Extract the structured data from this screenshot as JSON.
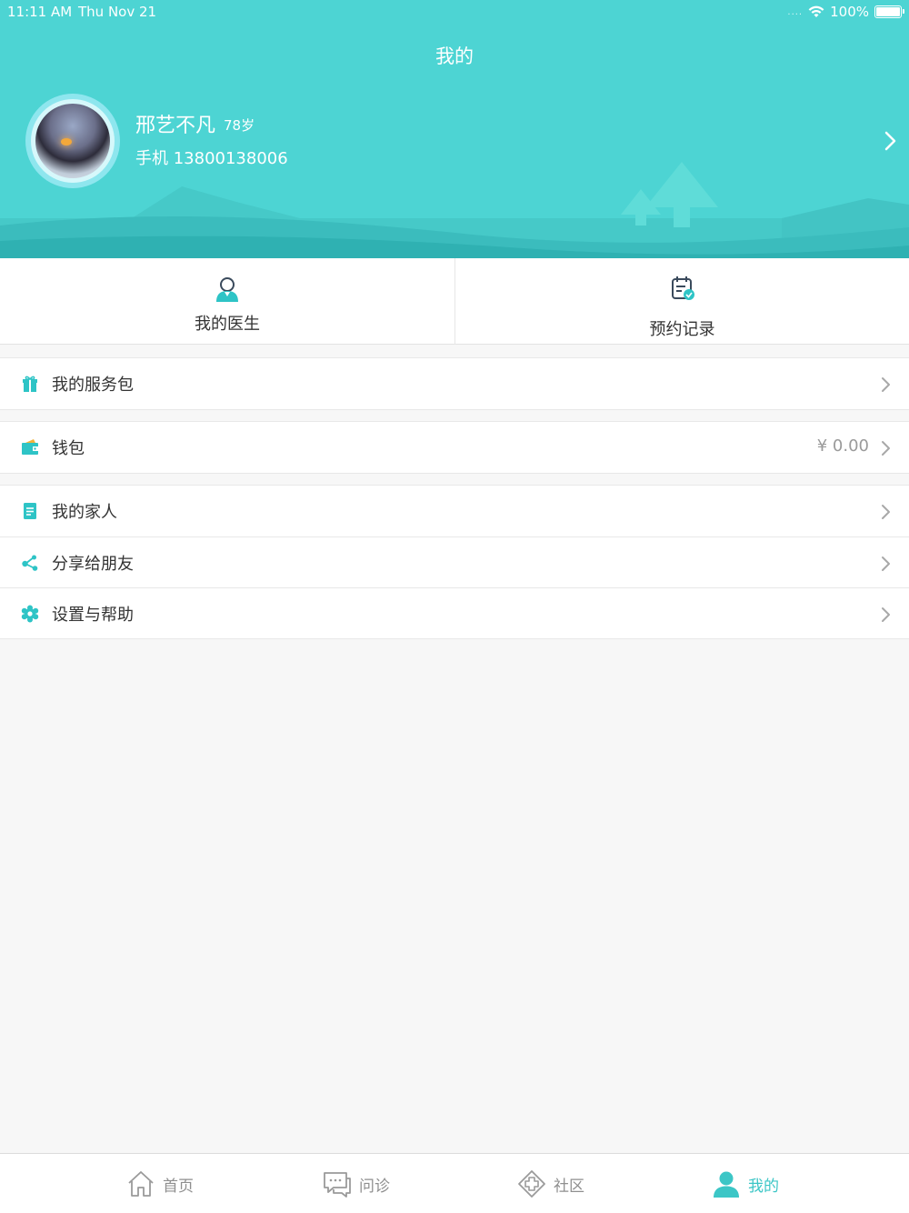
{
  "status_bar": {
    "time": "11:11 AM",
    "date": "Thu Nov 21",
    "signal": "....",
    "battery": "100%"
  },
  "header": {
    "title": "我的"
  },
  "profile": {
    "name": "邢艺不凡",
    "age": "78岁",
    "phone": "手机 13800138006"
  },
  "quick_actions": [
    {
      "label": "我的医生",
      "icon": "doctor-icon"
    },
    {
      "label": "预约记录",
      "icon": "calendar-icon"
    }
  ],
  "menu": {
    "service_package": {
      "label": "我的服务包",
      "icon": "gift-icon"
    },
    "wallet": {
      "label": "钱包",
      "value": "¥ 0.00",
      "icon": "wallet-icon"
    },
    "family": {
      "label": "我的家人",
      "icon": "document-icon"
    },
    "share": {
      "label": "分享给朋友",
      "icon": "share-icon"
    },
    "settings": {
      "label": "设置与帮助",
      "icon": "gear-icon"
    }
  },
  "tab_bar": {
    "tabs": [
      {
        "label": "首页",
        "icon": "home-icon"
      },
      {
        "label": "问诊",
        "icon": "chat-icon"
      },
      {
        "label": "社区",
        "icon": "community-icon"
      },
      {
        "label": "我的",
        "icon": "user-icon"
      }
    ],
    "active": "我的"
  },
  "colors": {
    "accent": "#4dd4d3",
    "icon": "#2ec4c6",
    "active_tab": "#3cc6c6",
    "muted": "#9a9a9a"
  }
}
